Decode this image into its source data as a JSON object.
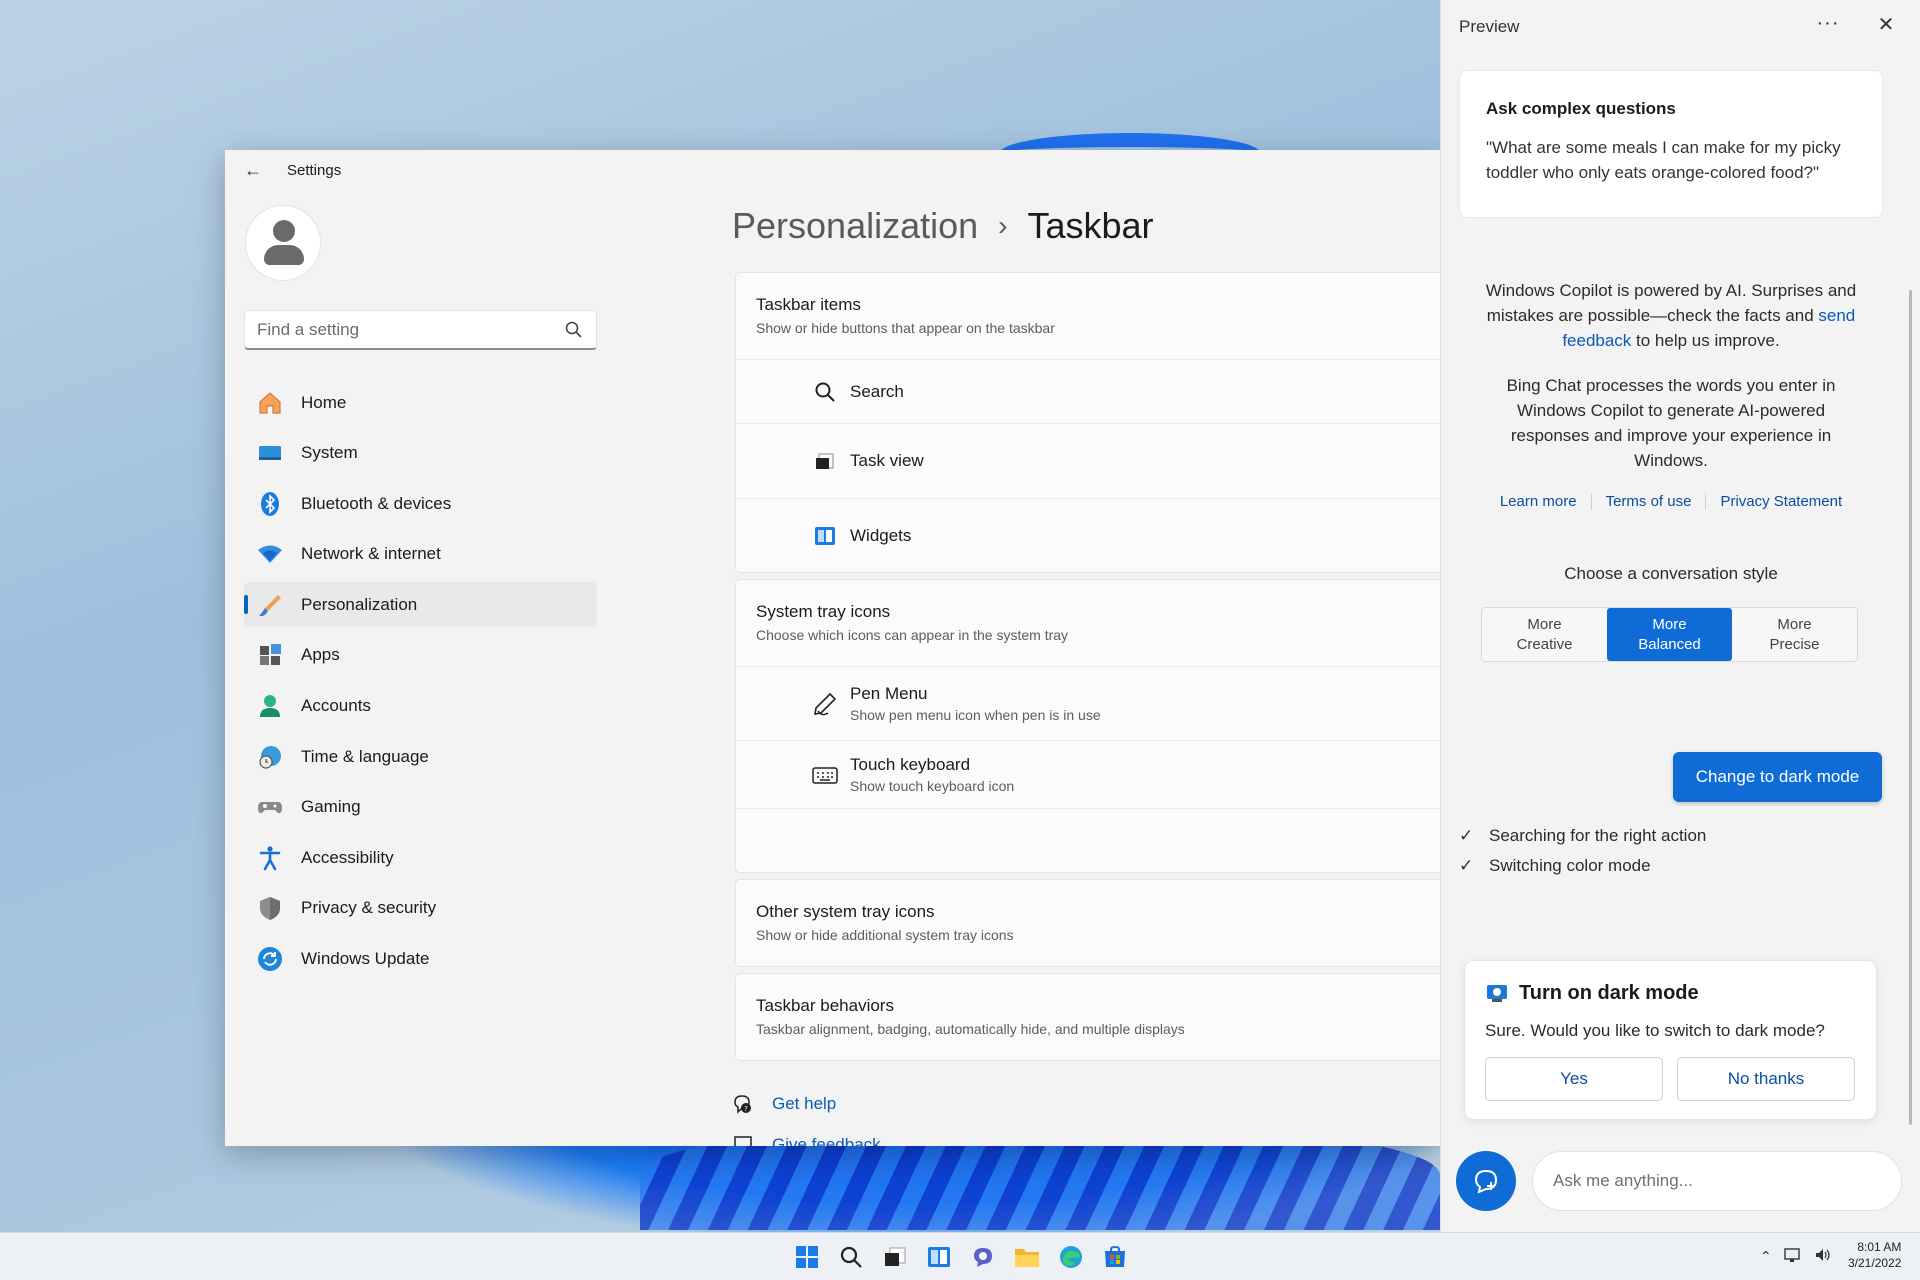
{
  "settings": {
    "window_title": "Settings",
    "search_placeholder": "Find a setting",
    "nav": [
      {
        "label": "Home"
      },
      {
        "label": "System"
      },
      {
        "label": "Bluetooth & devices"
      },
      {
        "label": "Network & internet"
      },
      {
        "label": "Personalization"
      },
      {
        "label": "Apps"
      },
      {
        "label": "Accounts"
      },
      {
        "label": "Time & language"
      },
      {
        "label": "Gaming"
      },
      {
        "label": "Accessibility"
      },
      {
        "label": "Privacy & security"
      },
      {
        "label": "Windows Update"
      }
    ],
    "breadcrumb": {
      "parent": "Personalization",
      "separator": "›",
      "current": "Taskbar"
    },
    "taskbar_items": {
      "title": "Taskbar items",
      "subtitle": "Show or hide buttons that appear on the taskbar",
      "rows": [
        {
          "label": "Search"
        },
        {
          "label": "Task view"
        },
        {
          "label": "Widgets"
        }
      ]
    },
    "system_tray": {
      "title": "System tray icons",
      "subtitle": "Choose which icons can appear in the system tray",
      "rows": [
        {
          "label": "Pen Menu",
          "sub": "Show pen menu icon when pen is in use"
        },
        {
          "label": "Touch keyboard",
          "sub": "Show touch keyboard icon"
        }
      ]
    },
    "other_tray": {
      "title": "Other system tray icons",
      "subtitle": "Show or hide additional system tray icons"
    },
    "behaviors": {
      "title": "Taskbar behaviors",
      "subtitle": "Taskbar alignment, badging, automatically hide, and multiple displays"
    },
    "get_help": "Get help",
    "give_feedback": "Give feedback"
  },
  "copilot": {
    "title": "Preview",
    "more": "···",
    "close": "✕",
    "question_card": {
      "title": "Ask complex questions",
      "text": "\"What are some meals I can make for my picky toddler who only eats orange-colored food?\""
    },
    "disclaimer": {
      "before": "Windows Copilot is powered by AI. Surprises and mistakes are possible—check the facts and ",
      "link": "send feedback",
      "after": " to help us improve."
    },
    "disclaimer2": "Bing Chat processes the words you enter in Windows Copilot to generate AI-powered responses and improve your experience in Windows.",
    "links": [
      "Learn more",
      "Terms of use",
      "Privacy Statement"
    ],
    "style_label": "Choose a conversation style",
    "styles": [
      {
        "line1": "More",
        "line2": "Creative"
      },
      {
        "line1": "More",
        "line2": "Balanced"
      },
      {
        "line1": "More",
        "line2": "Precise"
      }
    ],
    "selected_style": "More Balanced",
    "action_button": "Change to dark mode",
    "status": [
      "Searching for the right action",
      "Switching color mode"
    ],
    "dark_mode_card": {
      "title": "Turn on dark mode",
      "text": "Sure. Would you like to switch to dark mode?",
      "yes": "Yes",
      "no": "No thanks"
    },
    "input_placeholder": "Ask me anything..."
  },
  "taskbar": {
    "time": "8:01 AM",
    "date": "3/21/2022",
    "icons": [
      "windows-start-icon",
      "search-icon",
      "task-view-icon",
      "widgets-icon",
      "teams-chat-icon",
      "file-explorer-icon",
      "edge-icon",
      "store-icon"
    ]
  },
  "colors": {
    "accent": "#0f6cd6",
    "link": "#0a5ab8"
  }
}
